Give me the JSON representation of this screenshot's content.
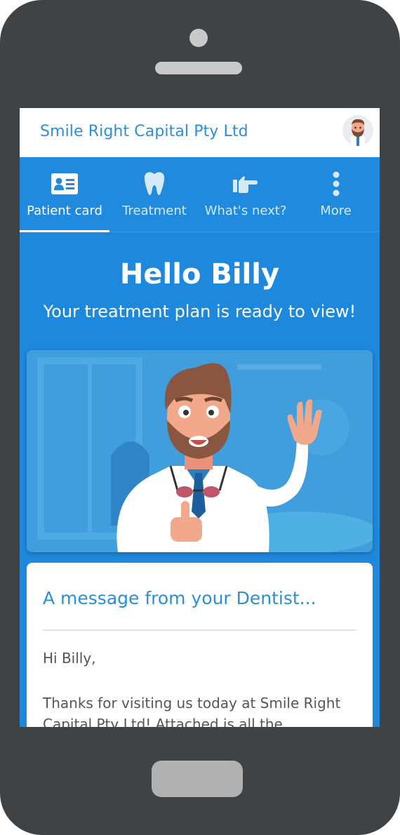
{
  "appbar": {
    "title": "Smile Right Capital Pty Ltd"
  },
  "tabs": [
    {
      "label": "Patient card",
      "icon": "id-card-icon",
      "active": true
    },
    {
      "label": "Treatment",
      "icon": "tooth-icon",
      "active": false
    },
    {
      "label": "What's next?",
      "icon": "pointing-hand-icon",
      "active": false
    },
    {
      "label": "More",
      "icon": "more-vertical-icon",
      "active": false
    }
  ],
  "hero": {
    "title": "Hello Billy",
    "subtitle": "Your treatment plan is ready to view!"
  },
  "message": {
    "title": "A message from your Dentist...",
    "greeting": "Hi Billy,",
    "body": "Thanks for visiting us today at Smile Right Capital Pty Ltd! Attached is all the information"
  },
  "colors": {
    "primary": "#1e88dc",
    "appbar_text": "#2a8fd6",
    "phone_frame": "#3f4346"
  }
}
